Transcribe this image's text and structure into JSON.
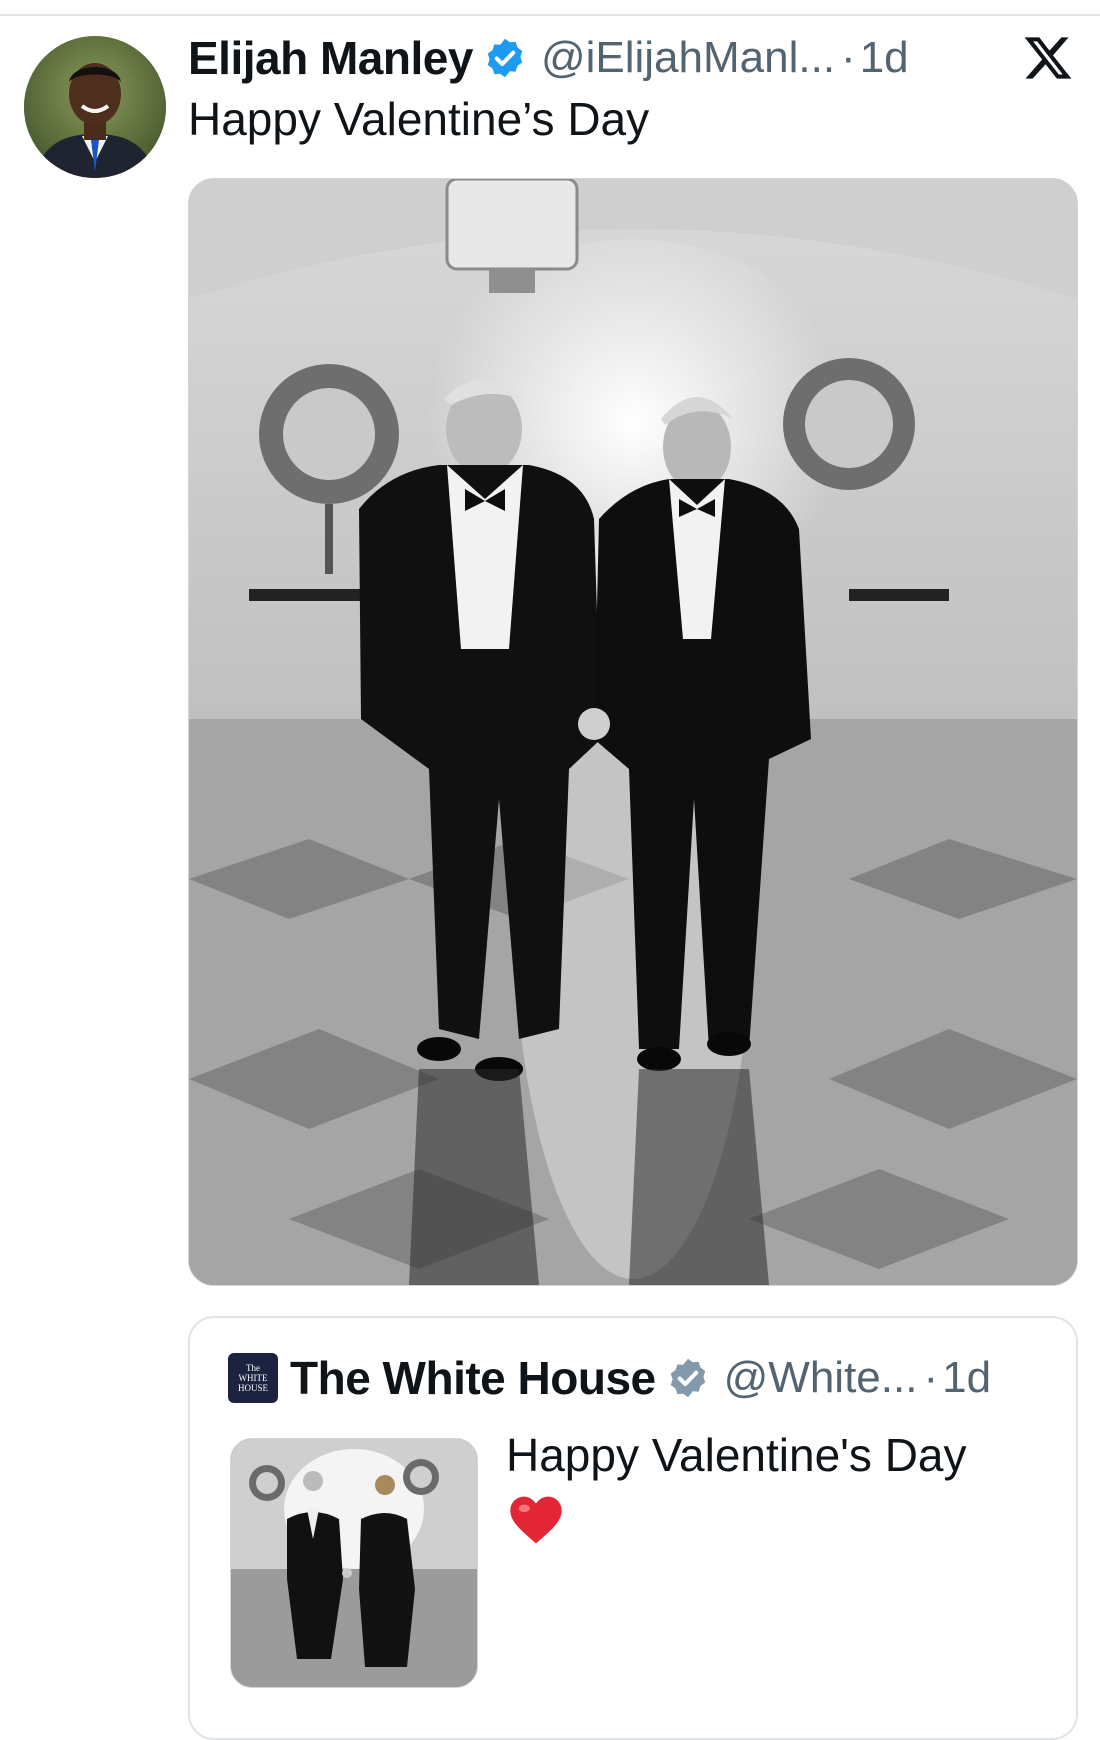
{
  "tweet": {
    "display_name": "Elijah Manley",
    "handle": "@iElijahManl...",
    "timestamp": "1d",
    "text": "Happy Valentine’s Day",
    "avatar_icon": "profile-photo",
    "verified_icon": "verified-badge-icon",
    "platform_icon": "x-logo-icon",
    "media": {
      "description_icon": "photo"
    }
  },
  "quote": {
    "display_name": "The White House",
    "handle": "@White...",
    "timestamp": "1d",
    "text": "Happy Valentine's Day",
    "emoji": "❤️",
    "avatar_lines": [
      "The",
      "WHITE",
      "HOUSE"
    ],
    "verified_icon": "gray-verified-badge-icon"
  },
  "colors": {
    "text": "#0f1419",
    "secondary": "#536471",
    "verified_blue": "#1d9bf0",
    "verified_gray": "#829aab",
    "divider": "#e1e4e8"
  }
}
